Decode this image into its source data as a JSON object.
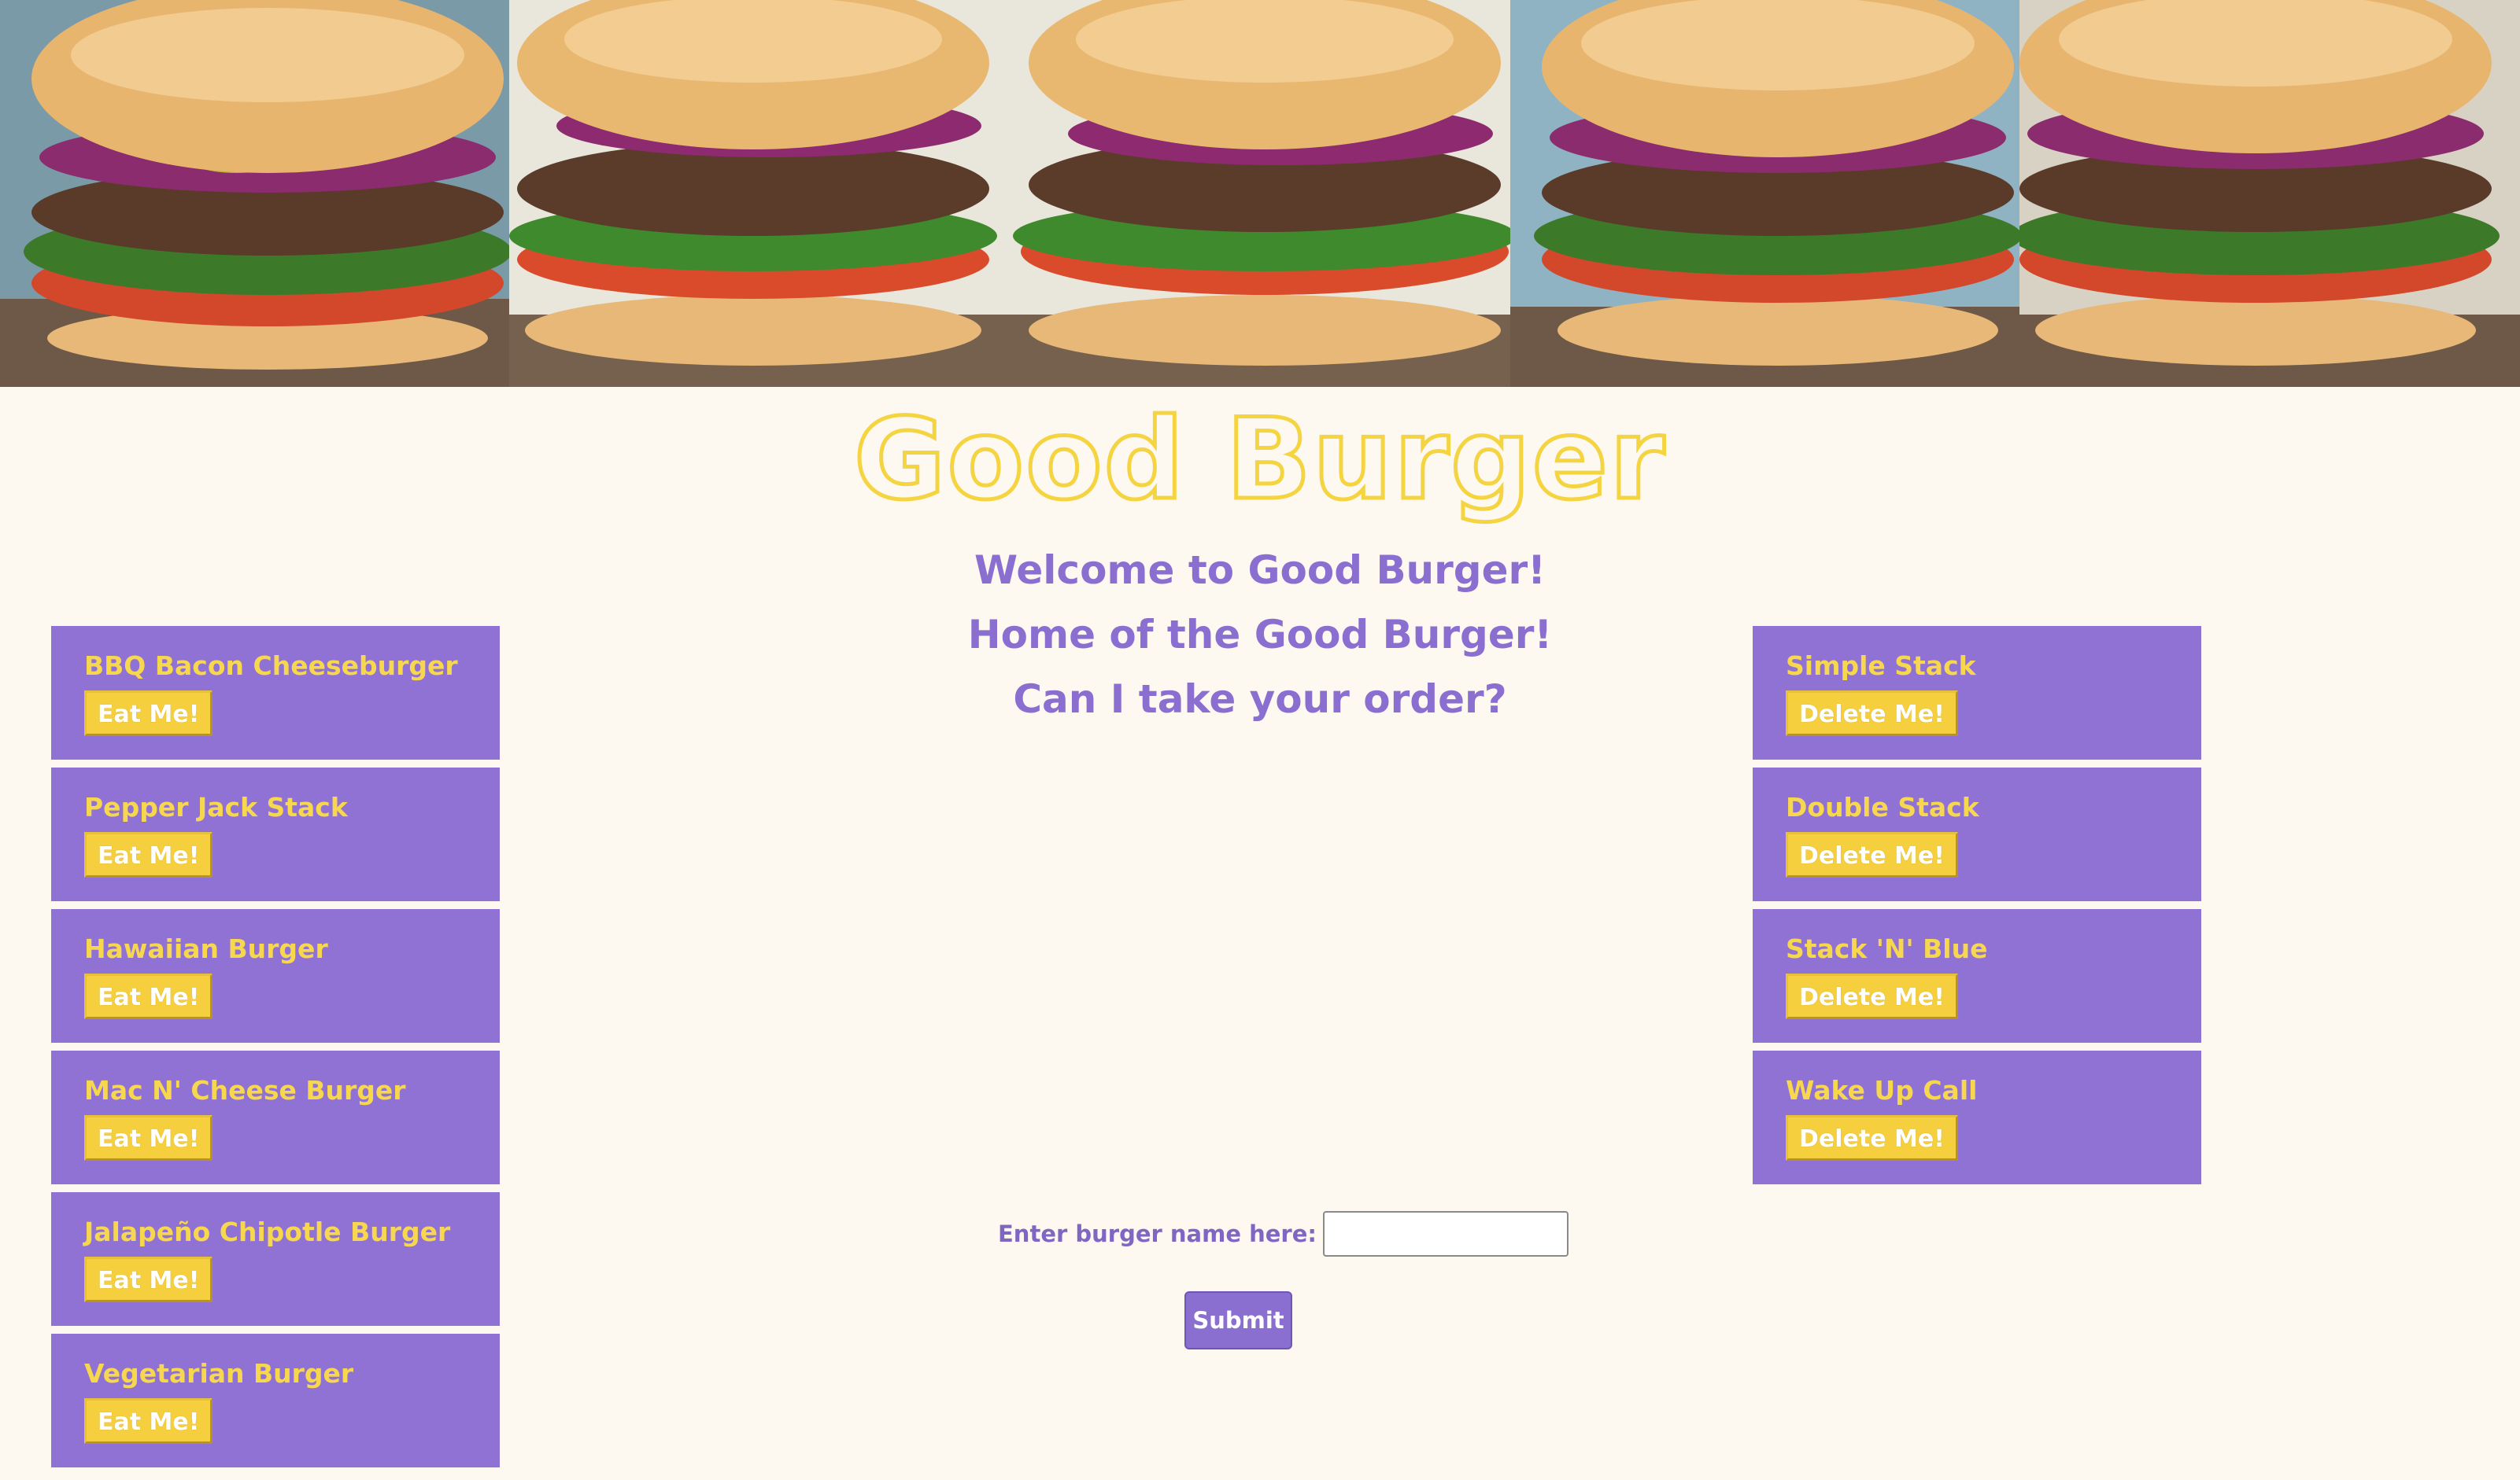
{
  "header": {
    "title": "Good Burger",
    "welcome_lines": [
      "Welcome to Good Burger!",
      "Home of the Good Burger!",
      "Can I take your order?"
    ]
  },
  "menu": {
    "button_label": "Eat Me!",
    "burgers": [
      "BBQ Bacon Cheeseburger",
      "Pepper Jack Stack",
      "Hawaiian Burger",
      "Mac N' Cheese Burger",
      "Jalapeño Chipotle Burger",
      "Vegetarian Burger"
    ]
  },
  "eaten": {
    "button_label": "Delete Me!",
    "burgers": [
      "Simple Stack",
      "Double Stack",
      "Stack 'N' Blue",
      "Wake Up Call"
    ]
  },
  "form": {
    "label": "Enter burger name here:",
    "input_value": "",
    "submit_label": "Submit"
  },
  "colors": {
    "background": "#fdf8f0",
    "card": "#9072d5",
    "accent_yellow": "#f5cf3e",
    "text_purple": "#8a6fd1"
  }
}
